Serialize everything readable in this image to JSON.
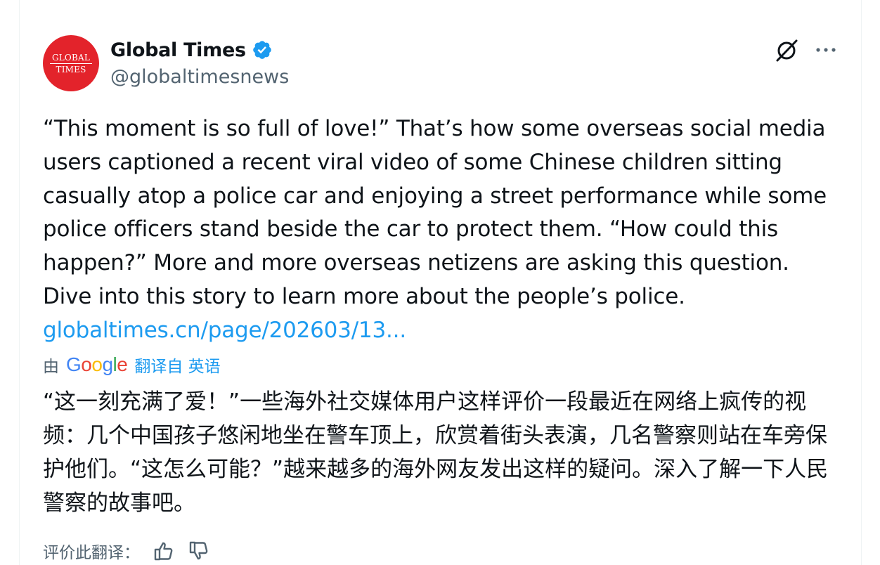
{
  "account": {
    "display_name": "Global Times",
    "handle": "@globaltimesnews",
    "avatar_line1": "GLOBAL",
    "avatar_line2": "TIMES",
    "verified_icon": "verified-badge-icon"
  },
  "tweet": {
    "text": "“This moment is so full of love!” That’s how some overseas social media users captioned a recent viral video of some Chinese children sitting casually atop a police car and enjoying a street performance while some police officers stand beside the car to protect them. “How could this happen?” More and more overseas netizens are asking this question. Dive into this story to learn more about the people’s police.",
    "link": "globaltimes.cn/page/202603/13..."
  },
  "translation": {
    "by_label": "由",
    "provider_letters": [
      "G",
      "o",
      "o",
      "g",
      "l",
      "e"
    ],
    "from_label": "翻译自 英语",
    "text": "“这一刻充满了爱！”一些海外社交媒体用户这样评价一段最近在网络上疯传的视频：几个中国孩子悠闲地坐在警车顶上，欣赏着街头表演，几名警察则站在车旁保护他们。“这怎么可能？”越来越多的海外网友发出这样的疑问。深入了解一下人民警察的故事吧。",
    "rate_label": "评价此翻译："
  },
  "colors": {
    "accent": "#1d9bf0",
    "secondary_text": "#536471",
    "avatar_bg": "#e3232b"
  }
}
